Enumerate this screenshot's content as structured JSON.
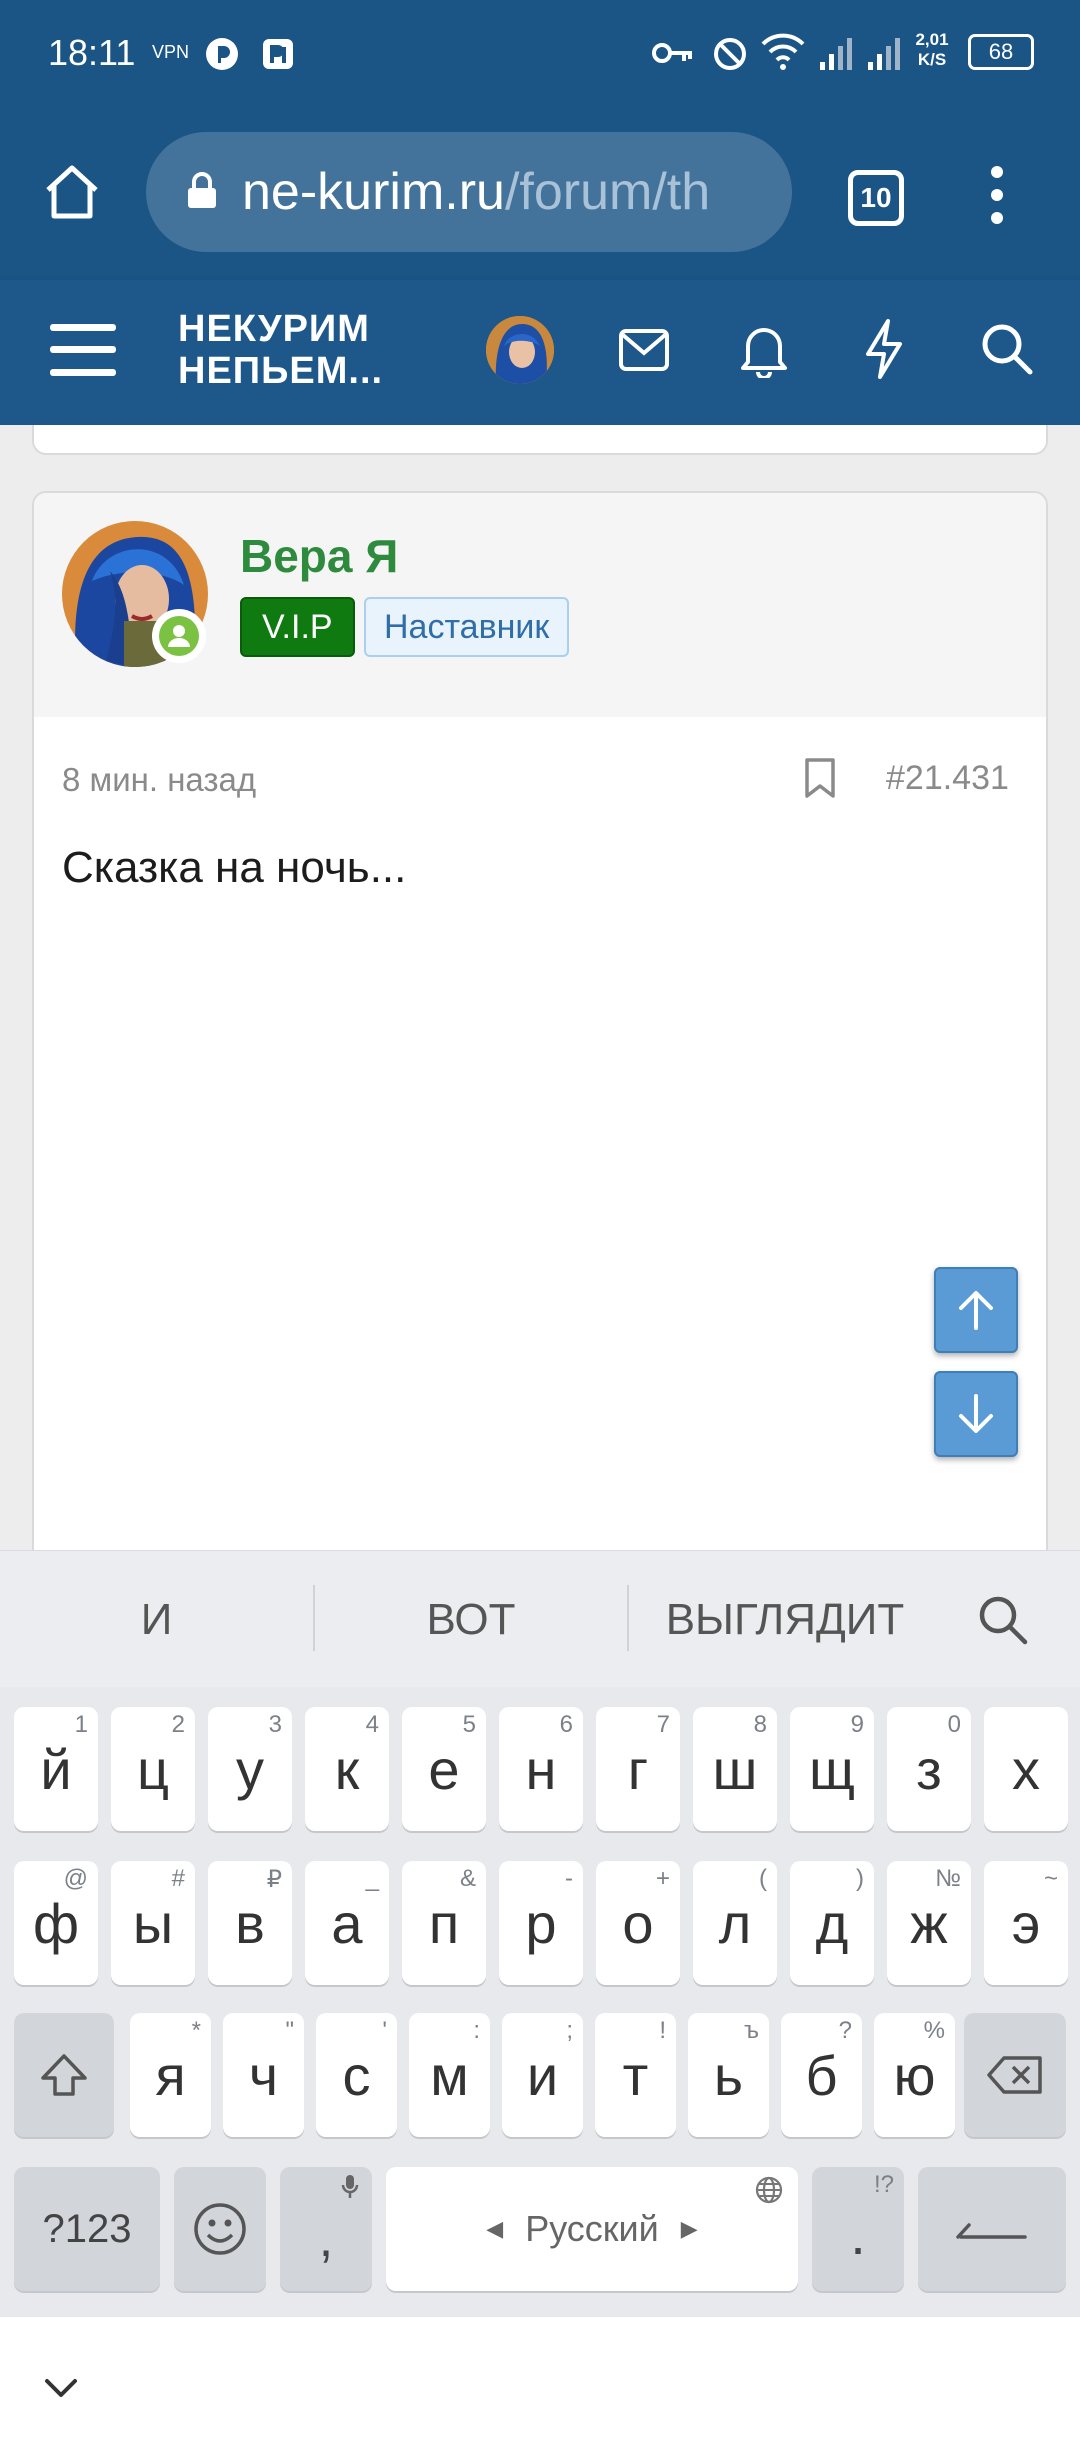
{
  "status_bar": {
    "time": "18:11",
    "vpn": "VPN",
    "speed_top": "2,01",
    "speed_bottom": "K/S",
    "battery": "68"
  },
  "browser": {
    "url_domain": "ne-kurim.ru",
    "url_path": "/forum/th",
    "tab_count": "10"
  },
  "app_nav": {
    "logo_line1": "НЕКУРИМ",
    "logo_line2": "НЕПЬЕМ..."
  },
  "post": {
    "author": "Вера Я",
    "badge_vip": "V.I.P",
    "badge_role": "Наставник",
    "time": "8 мин. назад",
    "number": "#21.431",
    "body": "Сказка на ночь..."
  },
  "suggestions": [
    "и",
    "вот",
    "выглядит"
  ],
  "keyboard": {
    "row1": [
      [
        "й",
        "1"
      ],
      [
        "ц",
        "2"
      ],
      [
        "у",
        "3"
      ],
      [
        "к",
        "4"
      ],
      [
        "е",
        "5"
      ],
      [
        "н",
        "6"
      ],
      [
        "г",
        "7"
      ],
      [
        "ш",
        "8"
      ],
      [
        "щ",
        "9"
      ],
      [
        "з",
        "0"
      ],
      [
        "х",
        ""
      ]
    ],
    "row2": [
      [
        "ф",
        "@"
      ],
      [
        "ы",
        "#"
      ],
      [
        "в",
        "₽"
      ],
      [
        "а",
        "_"
      ],
      [
        "п",
        "&"
      ],
      [
        "р",
        "-"
      ],
      [
        "о",
        "+"
      ],
      [
        "л",
        "("
      ],
      [
        "д",
        ")"
      ],
      [
        "ж",
        "№"
      ],
      [
        "э",
        "~"
      ]
    ],
    "row3": [
      [
        "я",
        "*"
      ],
      [
        "ч",
        "\""
      ],
      [
        "с",
        "'"
      ],
      [
        "м",
        ":"
      ],
      [
        "и",
        ";"
      ],
      [
        "т",
        "!"
      ],
      [
        "ь",
        "ъ"
      ],
      [
        "б",
        "?"
      ],
      [
        "ю",
        "%"
      ]
    ],
    "symbols_label": "?123",
    "comma": ",",
    "space_label": "Русский",
    "period": ".",
    "period_hint": "!?"
  },
  "colors": {
    "header_bg": "#1a5585",
    "author_green": "#2e8b3e",
    "vip_bg": "#0f7a0f",
    "role_badge_text": "#2f6ea8",
    "scroll_btn": "#5b9bd5"
  }
}
